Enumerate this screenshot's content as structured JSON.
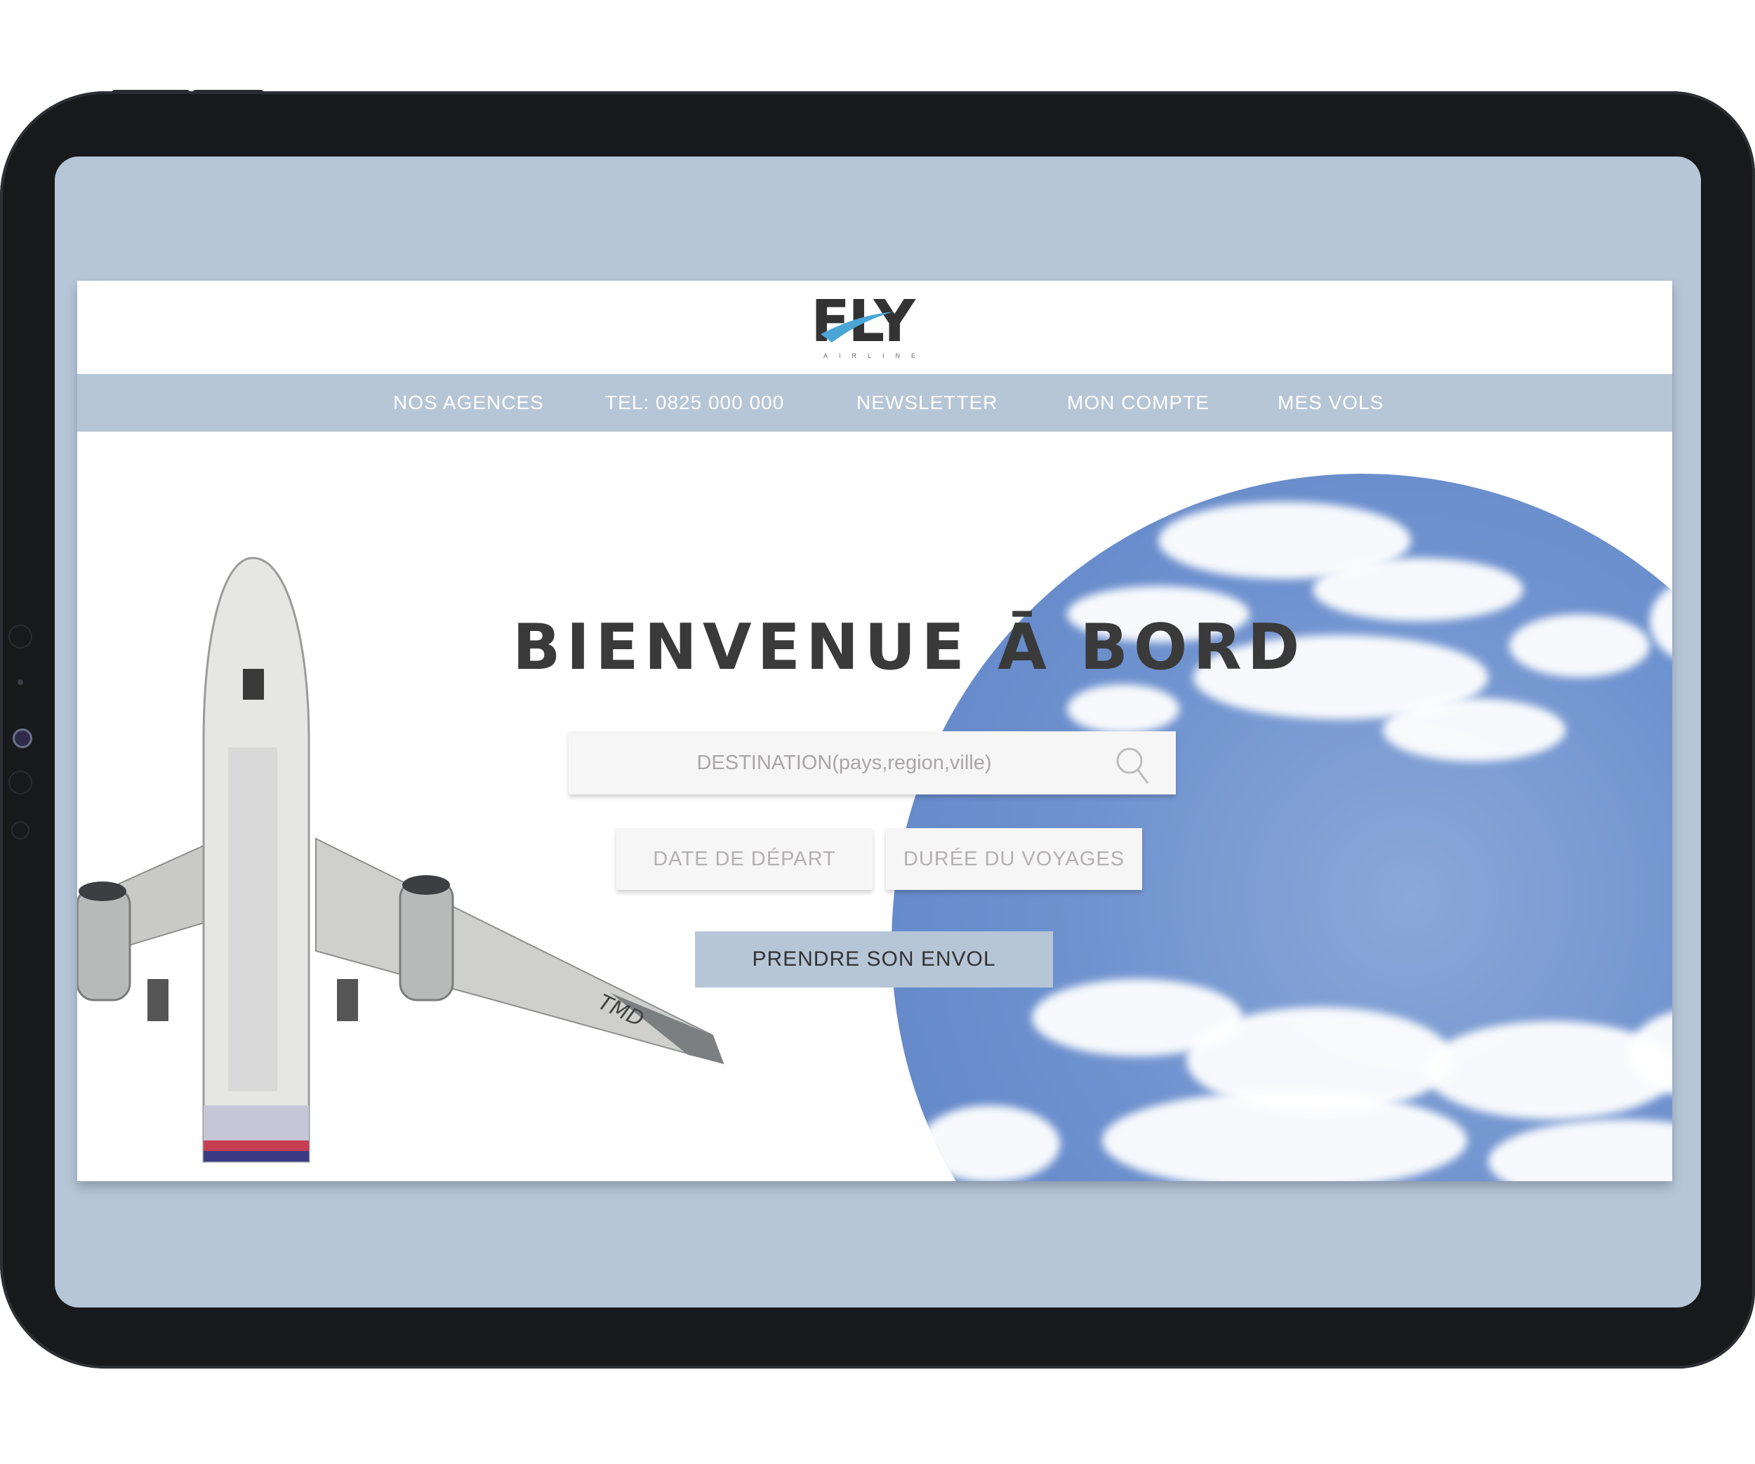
{
  "brand": {
    "logo_text": "FLY",
    "logo_sub": "AIRLINE",
    "accent_color": "#4aa6d6"
  },
  "nav": {
    "items": [
      {
        "label": "NOS AGENCES"
      },
      {
        "label": "TEL: 0825 000 000"
      },
      {
        "label": "NEWSLETTER"
      },
      {
        "label": "MON COMPTE"
      },
      {
        "label": "MES VOLS"
      }
    ]
  },
  "hero": {
    "title": "BIENVENUE Ā BORD",
    "aircraft_marking": "TMD"
  },
  "search": {
    "destination_placeholder": "DESTINATION(pays,region,ville)",
    "date_placeholder": "DATE DE DÉPART",
    "duration_placeholder": "DURÉE DU VOYAGES",
    "submit_label": "PRENDRE SON ENVOL",
    "icon": "search-icon"
  },
  "colors": {
    "nav_bg": "#b6c6d7",
    "device_frame": "#17191b",
    "title_text": "#3a3a3a",
    "sky": "#6f92cf"
  }
}
